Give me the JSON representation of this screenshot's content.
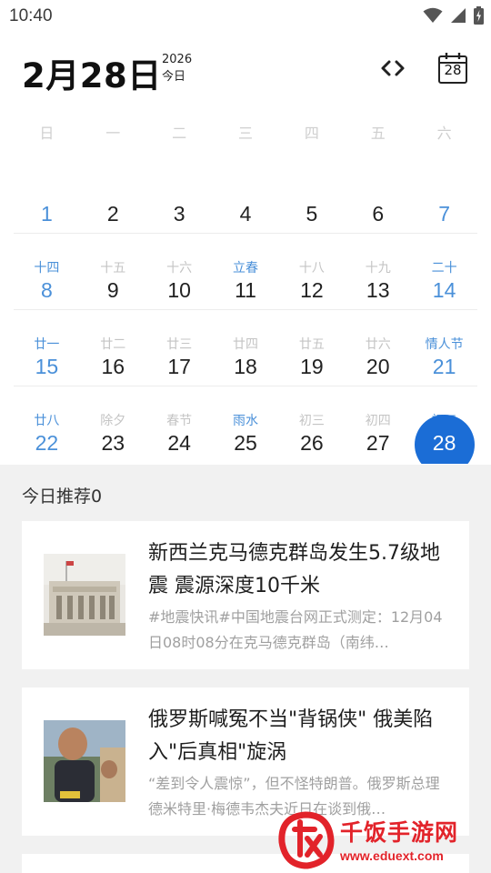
{
  "status_bar": {
    "time": "10:40",
    "icons": [
      "wifi-icon",
      "cellular-signal-icon",
      "battery-charging-icon"
    ]
  },
  "header": {
    "date": "2月28日",
    "year": "2026",
    "today_label": "今日",
    "calendar_button_day": "28"
  },
  "weekdays": [
    "日",
    "一",
    "二",
    "三",
    "四",
    "五",
    "六"
  ],
  "calendar": {
    "rows": [
      [
        {
          "lunar": "",
          "day": "1"
        },
        {
          "lunar": "",
          "day": "2"
        },
        {
          "lunar": "",
          "day": "3"
        },
        {
          "lunar": "",
          "day": "4"
        },
        {
          "lunar": "",
          "day": "5"
        },
        {
          "lunar": "",
          "day": "6"
        },
        {
          "lunar": "",
          "day": "7"
        }
      ],
      [
        {
          "lunar": "十四",
          "day": "8"
        },
        {
          "lunar": "十五",
          "day": "9"
        },
        {
          "lunar": "十六",
          "day": "10"
        },
        {
          "lunar": "立春",
          "day": "11"
        },
        {
          "lunar": "十八",
          "day": "12"
        },
        {
          "lunar": "十九",
          "day": "13"
        },
        {
          "lunar": "二十",
          "day": "14"
        }
      ],
      [
        {
          "lunar": "廿一",
          "day": "15"
        },
        {
          "lunar": "廿二",
          "day": "16"
        },
        {
          "lunar": "廿三",
          "day": "17"
        },
        {
          "lunar": "廿四",
          "day": "18"
        },
        {
          "lunar": "廿五",
          "day": "19"
        },
        {
          "lunar": "廿六",
          "day": "20"
        },
        {
          "lunar": "情人节",
          "day": "21"
        }
      ],
      [
        {
          "lunar": "廿八",
          "day": "22"
        },
        {
          "lunar": "除夕",
          "day": "23"
        },
        {
          "lunar": "春节",
          "day": "24"
        },
        {
          "lunar": "雨水",
          "day": "25"
        },
        {
          "lunar": "初三",
          "day": "26"
        },
        {
          "lunar": "初四",
          "day": "27"
        },
        {
          "lunar": "初五",
          "day": "28"
        }
      ]
    ],
    "highlighted_lunar": [
      "立春",
      "情人节",
      "雨水"
    ],
    "selected_day": "28"
  },
  "recommendations": {
    "title": "今日推荐0",
    "items": [
      {
        "headline": "新西兰克马德克群岛发生5.7级地震 震源深度10千米",
        "summary": "#地震快讯#中国地震台网正式测定：12月04日08时08分在克马德克群岛（南纬…",
        "thumbnail": "building-photo"
      },
      {
        "headline": "俄罗斯喊冤不当\"背锅侠\" 俄美陷入\"后真相\"旋涡",
        "summary": "“差到令人震惊”，但不怪特朗普。俄罗斯总理德米特里·梅德韦杰夫近日在谈到俄…",
        "thumbnail": "person-photo"
      }
    ]
  },
  "watermark": {
    "name": "千饭手游网",
    "url": "www.eduext.com"
  },
  "colors": {
    "accent": "#1b6dd6",
    "weekend": "#4a90d9",
    "panel_bg": "#f1f1f1",
    "watermark": "#e2232a"
  }
}
